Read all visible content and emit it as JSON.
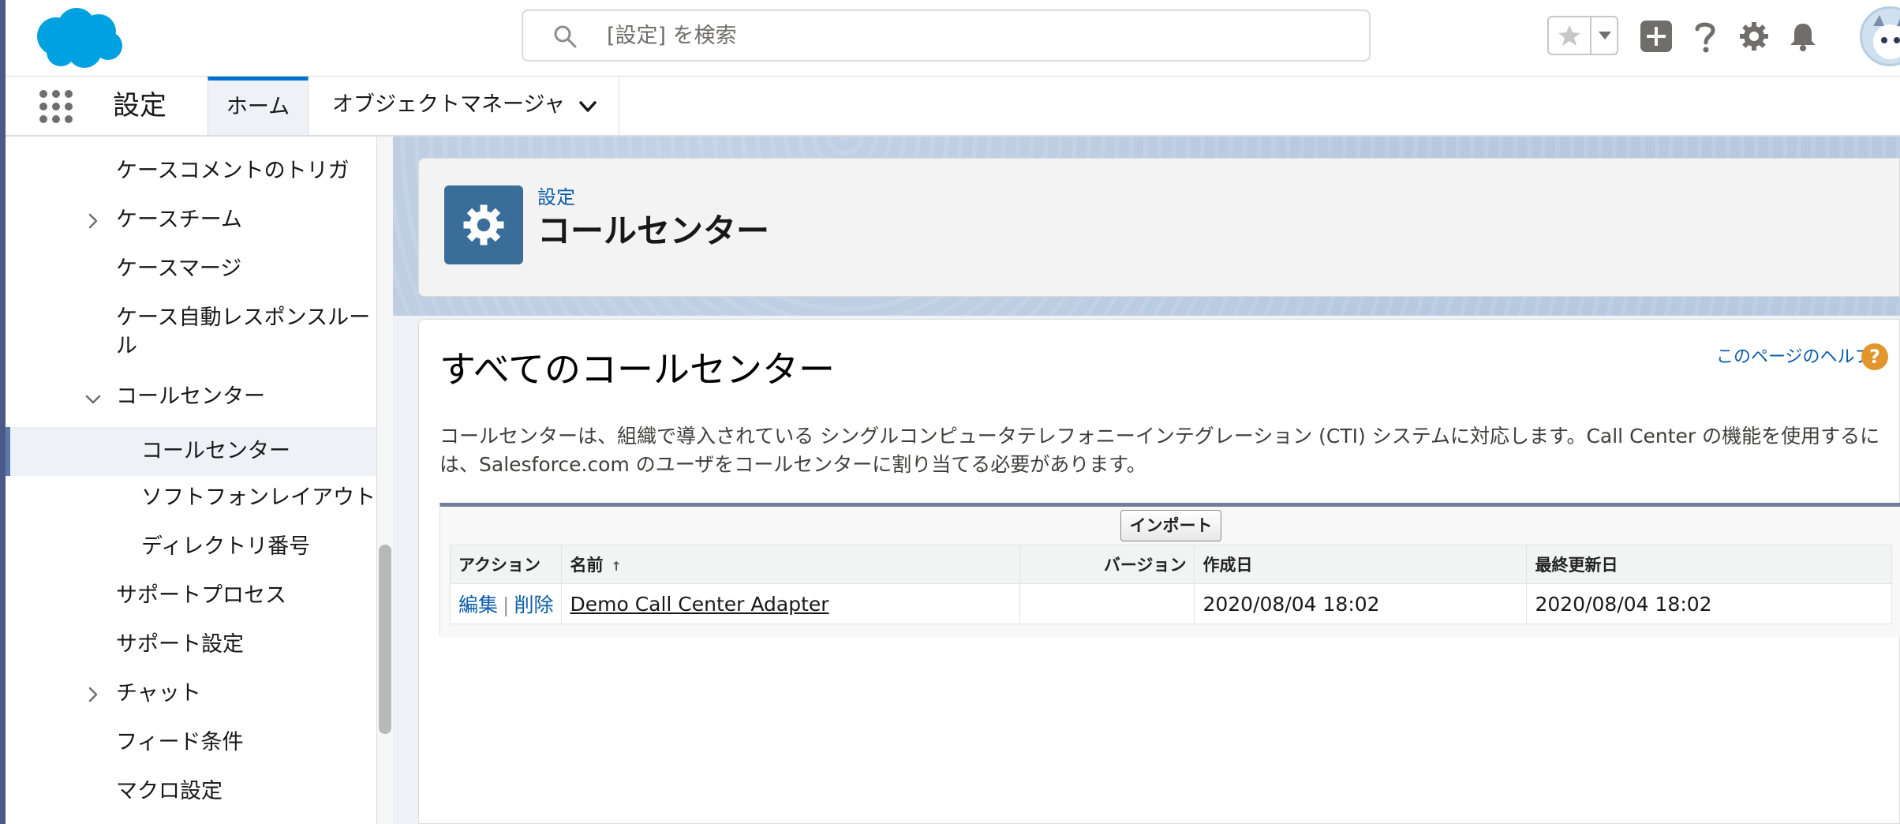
{
  "header": {
    "search_placeholder": "[設定] を検索"
  },
  "nav": {
    "app_title": "設定",
    "tabs": [
      {
        "label": "ホーム",
        "active": true
      },
      {
        "label": "オブジェクトマネージャ",
        "active": false
      }
    ]
  },
  "sidebar": {
    "items": [
      {
        "label": "ケースコメントのトリガ"
      },
      {
        "label": "ケースチーム",
        "expand": "collapsed"
      },
      {
        "label": "ケースマージ"
      },
      {
        "label": "ケース自動レスポンスルー",
        "label_line2": "ル"
      },
      {
        "label": "コールセンター",
        "expand": "expanded"
      },
      {
        "label": "コールセンター",
        "selected": true
      },
      {
        "label": "ソフトフォンレイアウト"
      },
      {
        "label": "ディレクトリ番号"
      },
      {
        "label": "サポートプロセス"
      },
      {
        "label": "サポート設定"
      },
      {
        "label": "チャット",
        "expand": "collapsed"
      },
      {
        "label": "フィード条件"
      },
      {
        "label": "マクロ設定"
      }
    ]
  },
  "page_header": {
    "breadcrumb": "設定",
    "title": "コールセンター",
    "icon": "gear-icon"
  },
  "main": {
    "section_title": "すべてのコールセンター",
    "help_link": "このページのヘルプ",
    "help_icon_glyph": "?",
    "description": "コールセンターは、組織で導入されている シングルコンピュータテレフォニーインテグレーション (CTI) システムに対応します。Call Center の機能を使用するには、Salesforce.com のユーザをコールセンターに割り当てる必要があります。",
    "import_button": "インポート",
    "table": {
      "columns": [
        "アクション",
        "名前",
        "バージョン",
        "作成日",
        "最終更新日"
      ],
      "sort_indicator": "↑",
      "rows": [
        {
          "edit": "編集",
          "separator": "|",
          "delete": "削除",
          "name": "Demo Call Center Adapter",
          "version": "",
          "created": "2020/08/04 18:02",
          "modified": "2020/08/04 18:02"
        }
      ]
    }
  },
  "colors": {
    "brand_blue": "#00a1e0",
    "link_blue": "#0b5cab",
    "icon_tile": "#3a6e98",
    "help_orange": "#e2952a"
  }
}
